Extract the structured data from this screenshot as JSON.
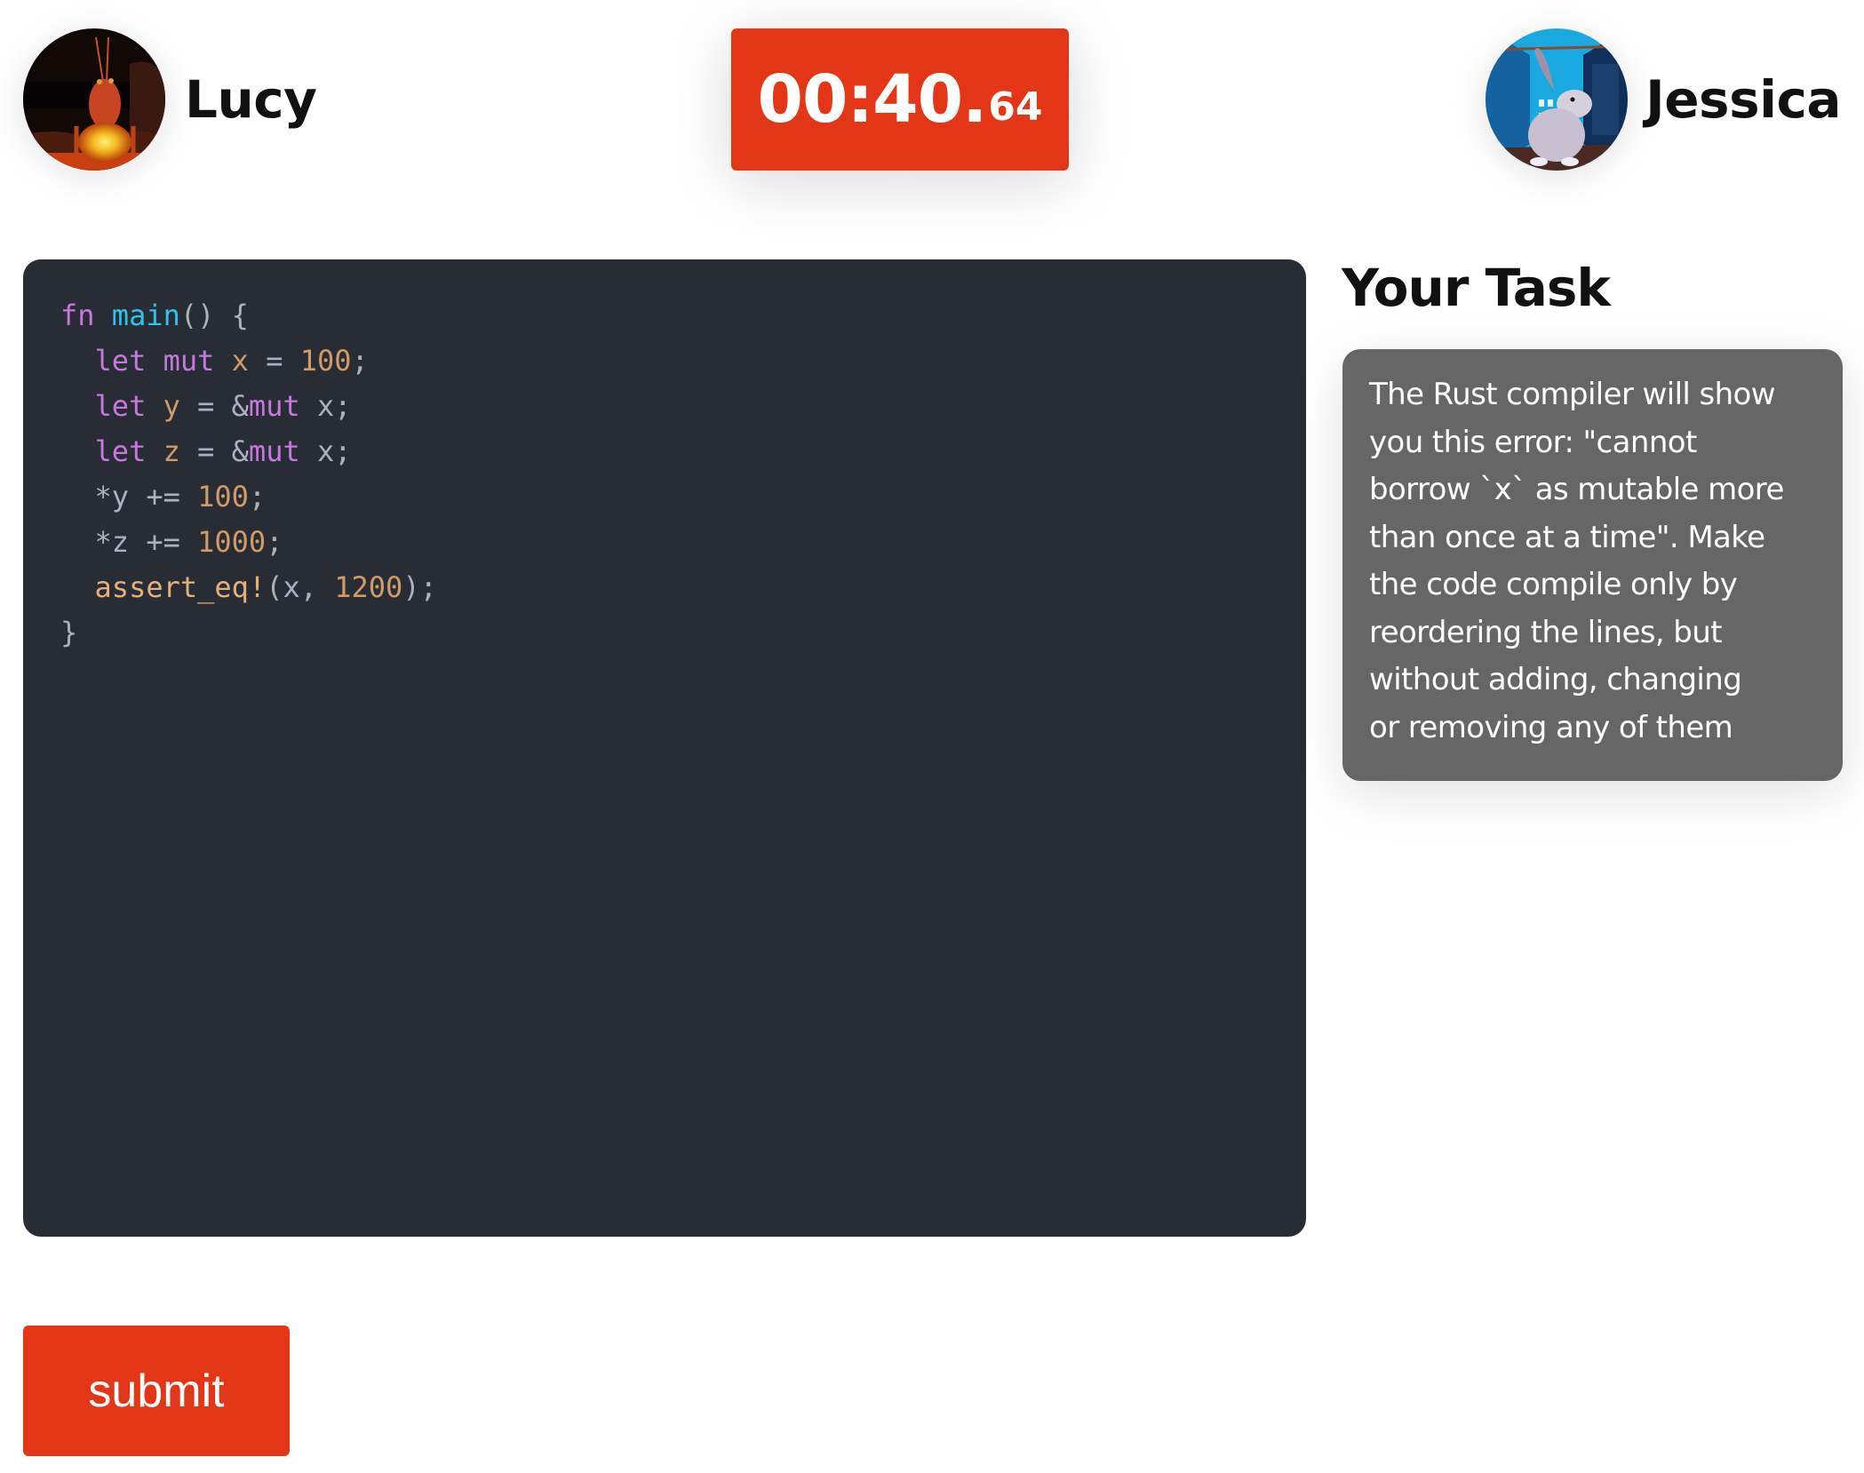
{
  "players": {
    "left": {
      "name": "Lucy",
      "avatar": "crayfish-campfire-avatar"
    },
    "right": {
      "name": "Jessica",
      "avatar": "rabbit-city-alley-avatar"
    }
  },
  "timer": {
    "main": "00:40.",
    "fraction": "64",
    "color": "#e23617"
  },
  "code": {
    "language": "rust",
    "lines": [
      [
        {
          "t": "fn",
          "k": "kw"
        },
        {
          "t": " ",
          "k": "plain"
        },
        {
          "t": "main",
          "k": "fn"
        },
        {
          "t": "() {",
          "k": "plain"
        }
      ],
      [
        {
          "t": "  ",
          "k": "plain"
        },
        {
          "t": "let",
          "k": "kw"
        },
        {
          "t": " ",
          "k": "plain"
        },
        {
          "t": "mut",
          "k": "kw"
        },
        {
          "t": " ",
          "k": "plain"
        },
        {
          "t": "x",
          "k": "var"
        },
        {
          "t": " = ",
          "k": "plain"
        },
        {
          "t": "100",
          "k": "num"
        },
        {
          "t": ";",
          "k": "plain"
        }
      ],
      [
        {
          "t": "  ",
          "k": "plain"
        },
        {
          "t": "let",
          "k": "kw"
        },
        {
          "t": " ",
          "k": "plain"
        },
        {
          "t": "y",
          "k": "var"
        },
        {
          "t": " = &",
          "k": "plain"
        },
        {
          "t": "mut",
          "k": "kw"
        },
        {
          "t": " x;",
          "k": "plain"
        }
      ],
      [
        {
          "t": "  ",
          "k": "plain"
        },
        {
          "t": "let",
          "k": "kw"
        },
        {
          "t": " ",
          "k": "plain"
        },
        {
          "t": "z",
          "k": "var"
        },
        {
          "t": " = &",
          "k": "plain"
        },
        {
          "t": "mut",
          "k": "kw"
        },
        {
          "t": " x;",
          "k": "plain"
        }
      ],
      [
        {
          "t": "  *y += ",
          "k": "plain"
        },
        {
          "t": "100",
          "k": "num"
        },
        {
          "t": ";",
          "k": "plain"
        }
      ],
      [
        {
          "t": "  *z += ",
          "k": "plain"
        },
        {
          "t": "1000",
          "k": "num"
        },
        {
          "t": ";",
          "k": "plain"
        }
      ],
      [
        {
          "t": "  ",
          "k": "plain"
        },
        {
          "t": "assert_eq!",
          "k": "macro"
        },
        {
          "t": "(x, ",
          "k": "plain"
        },
        {
          "t": "1200",
          "k": "num"
        },
        {
          "t": ");",
          "k": "plain"
        }
      ],
      [
        {
          "t": "}",
          "k": "plain"
        }
      ]
    ],
    "background": "#282c34"
  },
  "task": {
    "title": "Your Task",
    "lines": [
      "The Rust compiler will show",
      "you this error: \"cannot",
      "borrow `x` as mutable more",
      "than once at a time\". Make",
      "the code compile only by",
      "reordering the lines, but",
      "without adding, changing",
      "or removing any of them"
    ]
  },
  "submit": {
    "label": "submit"
  }
}
